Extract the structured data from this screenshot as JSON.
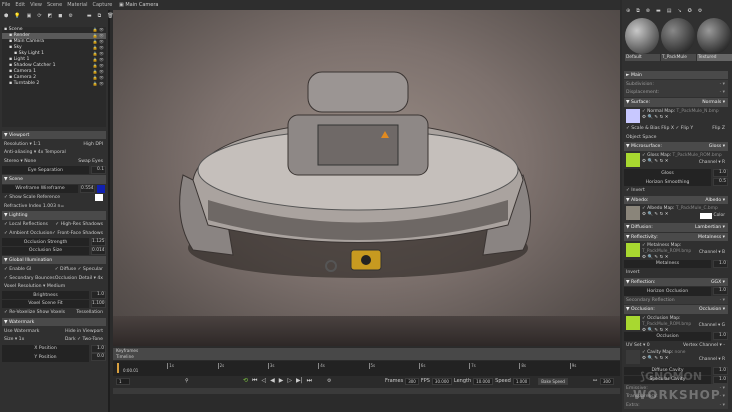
{
  "menu": [
    "File",
    "Edit",
    "View",
    "Scene",
    "Material",
    "Capture",
    "Help"
  ],
  "scene_tree": [
    {
      "label": "Scene",
      "depth": 0,
      "selected": false
    },
    {
      "label": "Render",
      "depth": 1,
      "selected": true
    },
    {
      "label": "Main Camera",
      "depth": 1,
      "selected": false
    },
    {
      "label": "Sky",
      "depth": 1,
      "selected": false
    },
    {
      "label": "Sky Light 1",
      "depth": 2,
      "selected": false
    },
    {
      "label": "Light 1",
      "depth": 1,
      "selected": false
    },
    {
      "label": "Shadow Catcher 1",
      "depth": 1,
      "selected": false
    },
    {
      "label": "Camera 1",
      "depth": 1,
      "selected": false
    },
    {
      "label": "Camera 2",
      "depth": 1,
      "selected": false
    },
    {
      "label": "Turntable 2",
      "depth": 1,
      "selected": false
    }
  ],
  "left_panel": [
    {
      "type": "hdr",
      "label": "▼ Viewport"
    },
    {
      "type": "pair",
      "a": "Resolution ▾ 1:1",
      "b": "High DPI",
      "bchk": false
    },
    {
      "type": "pair",
      "a": "Anti-aliasing ▾ 4x Temporal",
      "b": ""
    },
    {
      "type": "pair",
      "a": "Stereo ▾ None",
      "b": "Swap Eyes",
      "bchk": false
    },
    {
      "type": "slider",
      "label": "Eye Separation",
      "value": "0.1"
    },
    {
      "type": "hdr",
      "label": "▼ Scene"
    },
    {
      "type": "slider",
      "label": "Wireframe    Wireframe",
      "value": "0.554",
      "swatch": "#1020b0"
    },
    {
      "type": "pair",
      "a": "✓ Show Scale Reference",
      "b": "",
      "swatch": "#ffffff"
    },
    {
      "type": "pair",
      "a": "Refractive Index  1.003  n=",
      "b": ""
    },
    {
      "type": "hdr",
      "label": "▼ Lighting"
    },
    {
      "type": "pair",
      "a": "✓ Local Reflections",
      "b": "✓ High-Res Shadows"
    },
    {
      "type": "pair",
      "a": "✓ Ambient Occlusion",
      "b": "✓ Front-Face Shadows"
    },
    {
      "type": "slider",
      "label": "Occlusion Strength",
      "value": "1.125"
    },
    {
      "type": "slider",
      "label": "Occlusion Size",
      "value": "0.014"
    },
    {
      "type": "hdr",
      "label": "▼ Global Illumination"
    },
    {
      "type": "pair",
      "a": "✓ Enable GI",
      "b": "✓ Diffuse  ✓ Specular"
    },
    {
      "type": "pair",
      "a": "✓ Secondary Bounces",
      "b": "Occlusion Detail ▾ 4x"
    },
    {
      "type": "pair",
      "a": "Voxel Resolution ▾ Medium",
      "b": ""
    },
    {
      "type": "slider",
      "label": "Brightness",
      "value": "1.0"
    },
    {
      "type": "slider",
      "label": "Voxel Scene Fit",
      "value": "1.100"
    },
    {
      "type": "pair",
      "a": "✓ Re-Voxelize   Show Voxels",
      "b": "Tessellation"
    },
    {
      "type": "hdr",
      "label": "▼ Watermark"
    },
    {
      "type": "pair",
      "a": "Use Watermark",
      "b": "Hide in Viewport"
    },
    {
      "type": "pair",
      "a": "Size ▾ 1x",
      "b": "Dark  ✓ Two-Tone"
    },
    {
      "type": "slider",
      "label": "X Position",
      "value": "1.0"
    },
    {
      "type": "slider",
      "label": "Y Position",
      "value": "0.0"
    }
  ],
  "viewport": {
    "camera_tab": "Main Camera"
  },
  "timeline": {
    "keyframes_label": "Keyframes",
    "timeline_label": "Timeline",
    "current_time": "0:00.01",
    "ticks": [
      "1s",
      "2s",
      "3s",
      "4s",
      "5s",
      "6s",
      "7s",
      "8s",
      "9s"
    ],
    "frame_field": "1",
    "frames_label": "Frames",
    "frames": "300",
    "fps_label": "FPS",
    "fps": "30.000",
    "length_label": "Length",
    "length": "10.000",
    "speed_label": "Speed",
    "speed": "1.000",
    "bake_speed": "Bake Speed",
    "end_frame": "300",
    "transport": [
      "⟲",
      "⏮",
      "◁",
      "◀",
      "▶",
      "▷",
      "▶|",
      "⏭"
    ]
  },
  "materials": {
    "thumbs": [
      "Default",
      "T_PackMule",
      "Textured"
    ],
    "rows": [
      {
        "type": "hdr",
        "label": "► Main"
      },
      {
        "type": "sub",
        "label": "Subdivision:",
        "r": "- ▾"
      },
      {
        "type": "sub",
        "label": "Displacement:",
        "r": "- ▾"
      },
      {
        "type": "hdr",
        "label": "▼ Surface:",
        "r": "Normals ▾"
      },
      {
        "type": "tex",
        "label": "✓ Normal Map:",
        "file": "T_PackMule_N.bmp",
        "swatch": "#c8c8ff",
        "ch": ""
      },
      {
        "type": "pair",
        "a": "✓ Scale & Bias   Flip X  ✓ Flip Y",
        "b": "Flip Z"
      },
      {
        "type": "pair",
        "a": "Object Space",
        "b": ""
      },
      {
        "type": "hdr",
        "label": "▼ Microsurface:",
        "r": "Gloss ▾"
      },
      {
        "type": "tex",
        "label": "✓ Gloss Map:",
        "file": "T_PackMule_ROM.bmp",
        "swatch": "#a8d830",
        "ch": "Channel ▾ R"
      },
      {
        "type": "slider",
        "label": "Gloss",
        "value": "1.0"
      },
      {
        "type": "slider",
        "label": "Horizon Smoothing",
        "value": "0.5"
      },
      {
        "type": "pair",
        "a": "✓ Invert",
        "b": ""
      },
      {
        "type": "hdr",
        "label": "▼ Albedo:",
        "r": "Albedo ▾"
      },
      {
        "type": "tex",
        "label": "✓ Albedo Map:",
        "file": "T_PackMule_C.bmp",
        "swatch": "#8a857a",
        "ch": "Color",
        "chsw": "#ffffff"
      },
      {
        "type": "hdr",
        "label": "▼ Diffusion:",
        "r": "Lambertian ▾"
      },
      {
        "type": "hdr",
        "label": "▼ Reflectivity:",
        "r": "Metalness ▾"
      },
      {
        "type": "tex",
        "label": "✓ Metalness Map:",
        "file": "T_PackMule_ROM.bmp",
        "swatch": "#a8d830",
        "ch": "Channel ▾ B"
      },
      {
        "type": "slider",
        "label": "Metalness",
        "value": "1.0"
      },
      {
        "type": "pair",
        "a": "Invert",
        "b": ""
      },
      {
        "type": "hdr",
        "label": "▼ Reflection:",
        "r": "GGX ▾"
      },
      {
        "type": "slider",
        "label": "Horizon Occlusion",
        "value": "1.0"
      },
      {
        "type": "sub",
        "label": "Secondary Reflection",
        "r": "- ▾"
      },
      {
        "type": "hdr",
        "label": "▼ Occlusion:",
        "r": "Occlusion ▾"
      },
      {
        "type": "tex",
        "label": "✓ Occlusion Map:",
        "file": "T_PackMule_ROM.bmp",
        "swatch": "#a8d830",
        "ch": "Channel ▾ G"
      },
      {
        "type": "slider",
        "label": "Occlusion",
        "value": "1.0"
      },
      {
        "type": "pair",
        "a": "UV Set ▾ 0",
        "b": "Vertex Channel ▾ -"
      },
      {
        "type": "tex",
        "label": "✓ Cavity Map:",
        "file": "none",
        "swatch": "#3a3a3a",
        "ch": "Channel ▾ R"
      },
      {
        "type": "slider",
        "label": "Diffuse Cavity",
        "value": "1.0"
      },
      {
        "type": "slider",
        "label": "Specular Cavity",
        "value": "1.0"
      },
      {
        "type": "sub",
        "label": "Emissive:",
        "r": "- ▾"
      },
      {
        "type": "sub",
        "label": "Transparency:",
        "r": "- ▾"
      },
      {
        "type": "sub",
        "label": "Extra:",
        "r": "- ▾"
      }
    ]
  },
  "watermark_logo": "GNOMON WORKSHOP",
  "colors": {
    "accent_green": "#a8d830",
    "header": "#4a4a4a"
  }
}
